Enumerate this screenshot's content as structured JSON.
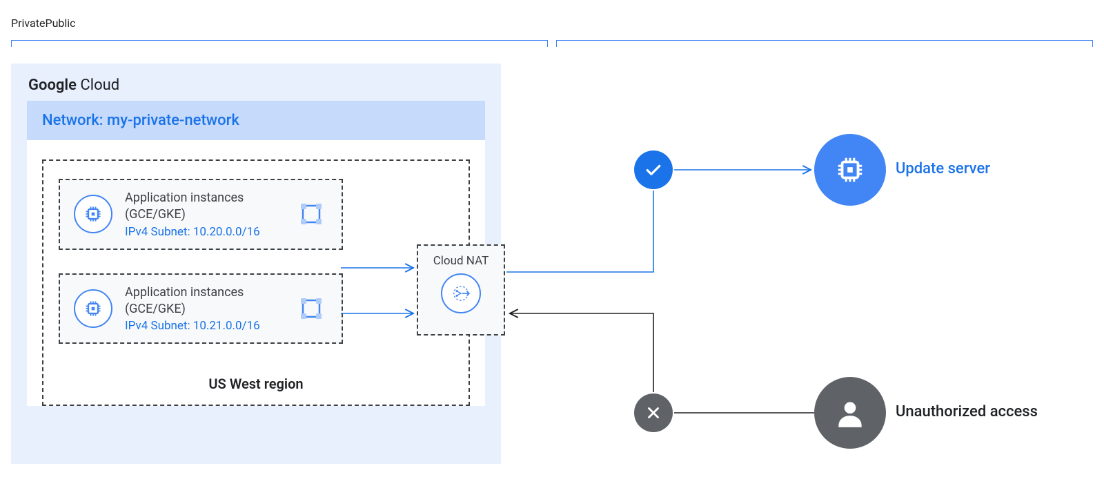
{
  "zones": {
    "private": "Private",
    "public": "Public"
  },
  "cloud": {
    "brand_bold": "Google",
    "brand_rest": " Cloud"
  },
  "network": {
    "label": "Network: my-private-network"
  },
  "region": {
    "label": "US West region"
  },
  "instances": [
    {
      "title_line1": "Application instances",
      "title_line2": "(GCE/GKE)",
      "subnet": "IPv4 Subnet: 10.20.0.0/16"
    },
    {
      "title_line1": "Application instances",
      "title_line2": "(GCE/GKE)",
      "subnet": "IPv4 Subnet: 10.21.0.0/16"
    }
  ],
  "nat": {
    "label": "Cloud NAT"
  },
  "public": {
    "update_server": "Update server",
    "unauthorized": "Unauthorized access"
  }
}
